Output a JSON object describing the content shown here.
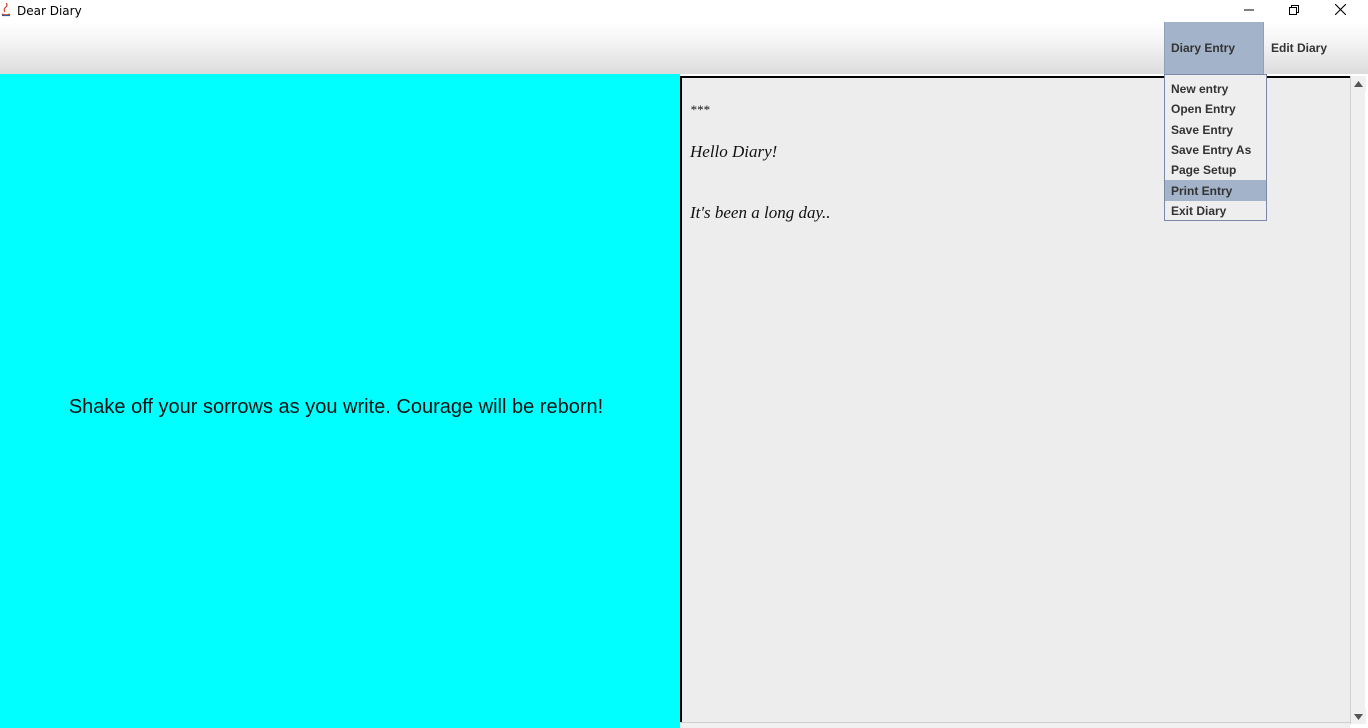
{
  "window": {
    "title": "Dear Diary",
    "icons": [
      "java-app-icon",
      "minimize-icon",
      "restore-icon",
      "close-icon"
    ]
  },
  "menubar": {
    "menus": [
      {
        "label": "Diary Entry",
        "open": true
      },
      {
        "label": "Edit Diary",
        "open": false
      }
    ]
  },
  "dropdown": {
    "items": [
      {
        "label": "New entry"
      },
      {
        "label": "Open Entry"
      },
      {
        "label": "Save Entry"
      },
      {
        "label": "Save Entry As"
      },
      {
        "label": "Page Setup"
      },
      {
        "label": "Print Entry",
        "highlighted": true
      },
      {
        "label": "Exit Diary"
      }
    ]
  },
  "left_panel": {
    "quote": "Shake off your sorrows as you write. Courage will be reborn!",
    "background": "#00ffff"
  },
  "editor": {
    "lines": [
      "***",
      "Hello Diary!",
      "It's been a long day.."
    ],
    "background": "#ededed"
  },
  "colors": {
    "menu_highlight": "#a3b3c9"
  }
}
